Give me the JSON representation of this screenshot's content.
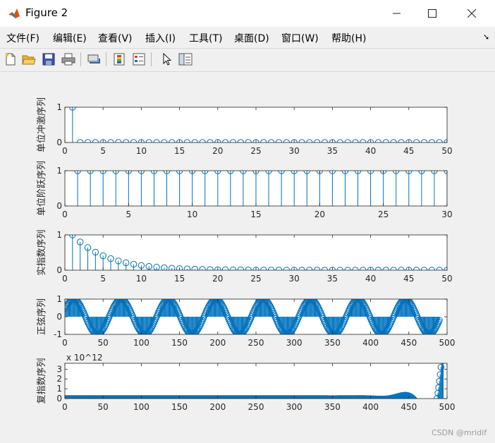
{
  "window": {
    "title": "Figure 2"
  },
  "menu": {
    "items": [
      "文件(F)",
      "编辑(E)",
      "查看(V)",
      "插入(I)",
      "工具(T)",
      "桌面(D)",
      "窗口(W)",
      "帮助(H)"
    ]
  },
  "toolbar": {
    "icons": [
      "new-figure-icon",
      "open-icon",
      "save-icon",
      "print-icon",
      "link-icon",
      "colorbar-icon",
      "legend-icon",
      "pointer-icon",
      "property-icon"
    ]
  },
  "watermark": "CSDN @mridif",
  "chart_data": [
    {
      "type": "stem",
      "ylabel": "单位冲激序列",
      "xlim": [
        0,
        50
      ],
      "ylim": [
        0,
        1
      ],
      "xticks": [
        "0",
        "5",
        "10",
        "15",
        "20",
        "25",
        "30",
        "35",
        "40",
        "45",
        "50"
      ],
      "yticks": [
        "0",
        "1"
      ],
      "x_range": [
        1,
        50
      ],
      "values_rule": "impulse at n=1 (value 1), 0 elsewhere",
      "color": "#0072bd"
    },
    {
      "type": "stem",
      "ylabel": "单位阶跃序列",
      "xlim": [
        0,
        30
      ],
      "ylim": [
        0,
        1
      ],
      "xticks": [
        "0",
        "5",
        "10",
        "15",
        "20",
        "25",
        "30"
      ],
      "yticks": [
        "0",
        "1"
      ],
      "x_range": [
        1,
        30
      ],
      "values_rule": "all values 1",
      "color": "#0072bd"
    },
    {
      "type": "stem",
      "ylabel": "实指数序列",
      "xlim": [
        0,
        50
      ],
      "ylim": [
        0,
        1
      ],
      "xticks": [
        "0",
        "5",
        "10",
        "15",
        "20",
        "25",
        "30",
        "35",
        "40",
        "45",
        "50"
      ],
      "yticks": [
        "0",
        "1"
      ],
      "x_range": [
        1,
        50
      ],
      "values_rule": "0.8^(n-1)",
      "color": "#0072bd"
    },
    {
      "type": "stem",
      "ylabel": "正弦序列",
      "xlim": [
        0,
        500
      ],
      "ylim": [
        -1,
        1
      ],
      "xticks": [
        "0",
        "50",
        "100",
        "150",
        "200",
        "250",
        "300",
        "350",
        "400",
        "450",
        "500"
      ],
      "yticks": [
        "-1",
        "0",
        "1"
      ],
      "x_range": [
        1,
        490
      ],
      "values_rule": "sin(2*pi*(n+4)/62)",
      "color": "#0072bd"
    },
    {
      "type": "stem",
      "ylabel": "复指数序列",
      "xlim": [
        0,
        500
      ],
      "ylim": [
        0,
        3.6
      ],
      "exponent": "x 10^12",
      "xticks": [
        "0",
        "50",
        "100",
        "150",
        "200",
        "250",
        "300",
        "350",
        "400",
        "450",
        "500"
      ],
      "yticks": [
        "0",
        "1",
        "2",
        "3"
      ],
      "x_range": [
        1,
        495
      ],
      "values_rule": "real part of exp((0.06 + 0.1i) * n), shown in units of 10^12",
      "color": "#0072bd"
    }
  ]
}
